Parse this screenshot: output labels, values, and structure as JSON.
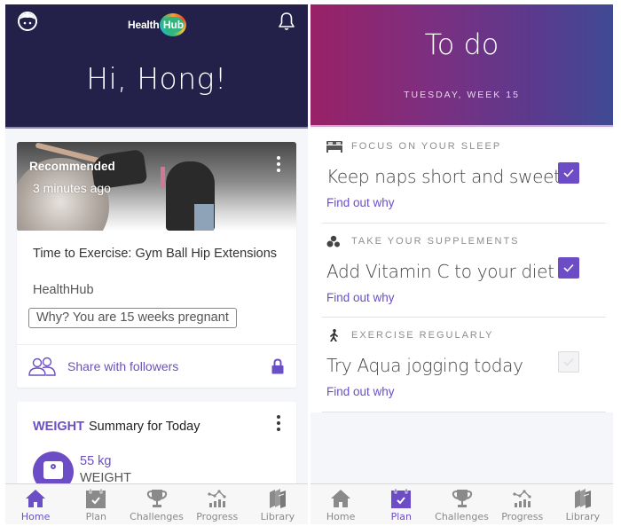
{
  "colors": {
    "accent": "#6b4fc4",
    "home_header_bg": "#23214a",
    "plan_header_gradient": [
      "#992167",
      "#3f4a93"
    ]
  },
  "home": {
    "header": {
      "logo_part1": "Health",
      "logo_part2": "Hub",
      "greeting": "Hi, Hong!",
      "left_icon": "user-avatar-icon",
      "right_icon": "bell-icon"
    },
    "recommended_card": {
      "badge": "Recommended",
      "time": "3 minutes ago",
      "title": "Time to Exercise: Gym Ball Hip Extensions",
      "source": "HealthHub",
      "reason": "Why? You are 15 weeks pregnant",
      "share_label": "Share with followers",
      "share_icon": "followers-icon",
      "privacy_icon": "lock-icon"
    },
    "weight_card": {
      "tag": "WEIGHT",
      "title": "Summary for Today",
      "value": "55 kg",
      "label": "WEIGHT",
      "icon": "scale-icon"
    }
  },
  "plan": {
    "header": {
      "title": "To do",
      "date": "TUESDAY, WEEK 15"
    },
    "tasks": [
      {
        "category": "FOCUS ON YOUR SLEEP",
        "icon": "bed-icon",
        "title": "Keep naps short and sweet",
        "link": "Find out why",
        "checked": true
      },
      {
        "category": "TAKE YOUR SUPPLEMENTS",
        "icon": "pills-icon",
        "title": "Add Vitamin C to your diet",
        "link": "Find out why",
        "checked": true
      },
      {
        "category": "EXERCISE REGULARLY",
        "icon": "walking-icon",
        "title": "Try Aqua jogging today",
        "link": "Find out why",
        "checked": false
      }
    ]
  },
  "tabbar": {
    "tabs": [
      {
        "label": "Home",
        "icon": "home-icon"
      },
      {
        "label": "Plan",
        "icon": "calendar-check-icon"
      },
      {
        "label": "Challenges",
        "icon": "trophy-icon"
      },
      {
        "label": "Progress",
        "icon": "chart-icon"
      },
      {
        "label": "Library",
        "icon": "books-icon"
      }
    ],
    "home_screen_active": "Home",
    "plan_screen_active": "Plan"
  }
}
